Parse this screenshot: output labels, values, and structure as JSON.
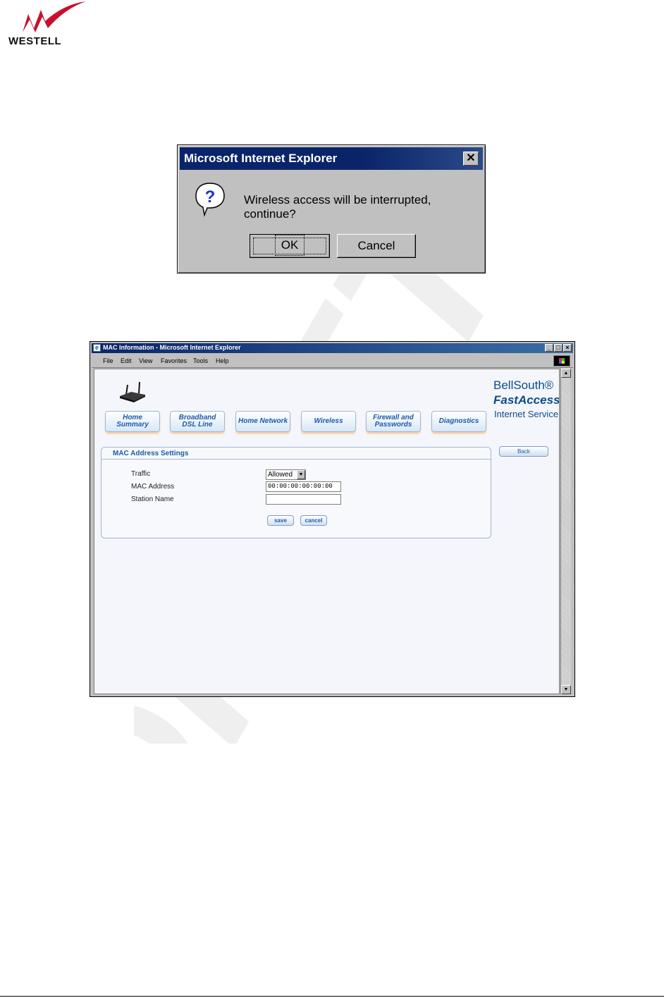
{
  "logo": {
    "text": "WESTELL",
    "registered_mark": "®"
  },
  "dialog": {
    "title": "Microsoft Internet Explorer",
    "close_glyph": "✕",
    "icon": "question-icon",
    "message": "Wireless access will be interrupted, continue?",
    "ok_label": "OK",
    "cancel_label": "Cancel"
  },
  "browser": {
    "title": "MAC Information - Microsoft Internet Explorer",
    "menu": [
      "File",
      "Edit",
      "View",
      "Favorites",
      "Tools",
      "Help"
    ],
    "nav_tabs": [
      "Home Summary",
      "Broadband DSL Line",
      "Home Network",
      "Wireless",
      "Firewall and Passwords",
      "Diagnostics"
    ],
    "brand": {
      "line1": "BellSouth®",
      "line2": "FastAccess®",
      "line3": "Internet Service"
    },
    "back_label": "Back",
    "panel": {
      "title": "MAC Address Settings",
      "traffic_label": "Traffic",
      "traffic_value": "Allowed",
      "mac_label": "MAC Address",
      "mac_value": "00:00:00:00:00:00",
      "station_label": "Station Name",
      "station_value": "",
      "save_label": "save",
      "cancel_label": "cancel"
    }
  },
  "watermark": {
    "text": "DRAFT 5",
    "color": "#eeeeee"
  },
  "colors": {
    "win_blue": "#0a246a",
    "link_blue": "#1f5aa8",
    "accent_orange": "#f4c08a",
    "window_gray": "#c0c0c0"
  }
}
